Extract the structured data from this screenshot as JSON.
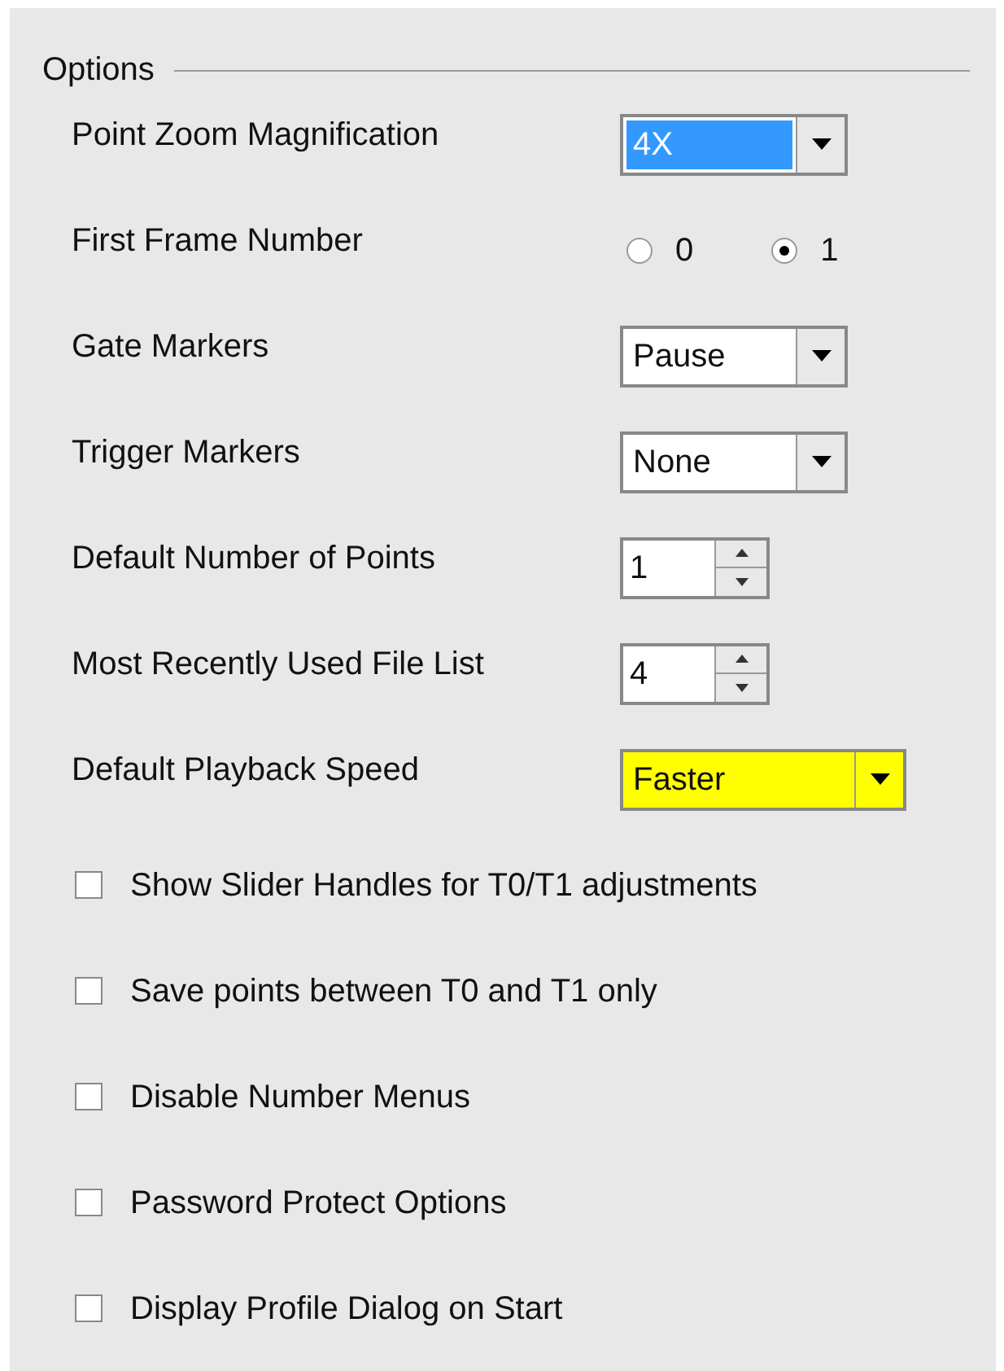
{
  "group": {
    "legend": "Options",
    "rows": [
      {
        "kind": "dropdown",
        "label": "Point Zoom Magnification",
        "value": "4X",
        "selected": true,
        "highlighted": false
      },
      {
        "kind": "radio",
        "label": "First Frame Number",
        "options": [
          {
            "label": "0",
            "selected": false
          },
          {
            "label": "1",
            "selected": true
          }
        ]
      },
      {
        "kind": "dropdown",
        "label": "Gate Markers",
        "value": "Pause",
        "selected": false,
        "highlighted": false
      },
      {
        "kind": "dropdown",
        "label": "Trigger Markers",
        "value": "None",
        "selected": false,
        "highlighted": false
      },
      {
        "kind": "spin",
        "label": "Default Number of Points",
        "value": "1"
      },
      {
        "kind": "spin",
        "label": "Most Recently Used File List",
        "value": "4"
      },
      {
        "kind": "dropdown",
        "label": "Default Playback Speed",
        "value": "Faster",
        "selected": false,
        "highlighted": true
      },
      {
        "kind": "checkbox",
        "label": "Show Slider Handles for T0/T1 adjustments",
        "checked": false
      },
      {
        "kind": "checkbox",
        "label": "Save points between T0 and T1 only",
        "checked": false
      },
      {
        "kind": "checkbox",
        "label": "Disable Number Menus",
        "checked": false
      },
      {
        "kind": "checkbox",
        "label": "Password Protect Options",
        "checked": false
      },
      {
        "kind": "checkbox",
        "label": "Display Profile Dialog on Start",
        "checked": false
      }
    ]
  }
}
